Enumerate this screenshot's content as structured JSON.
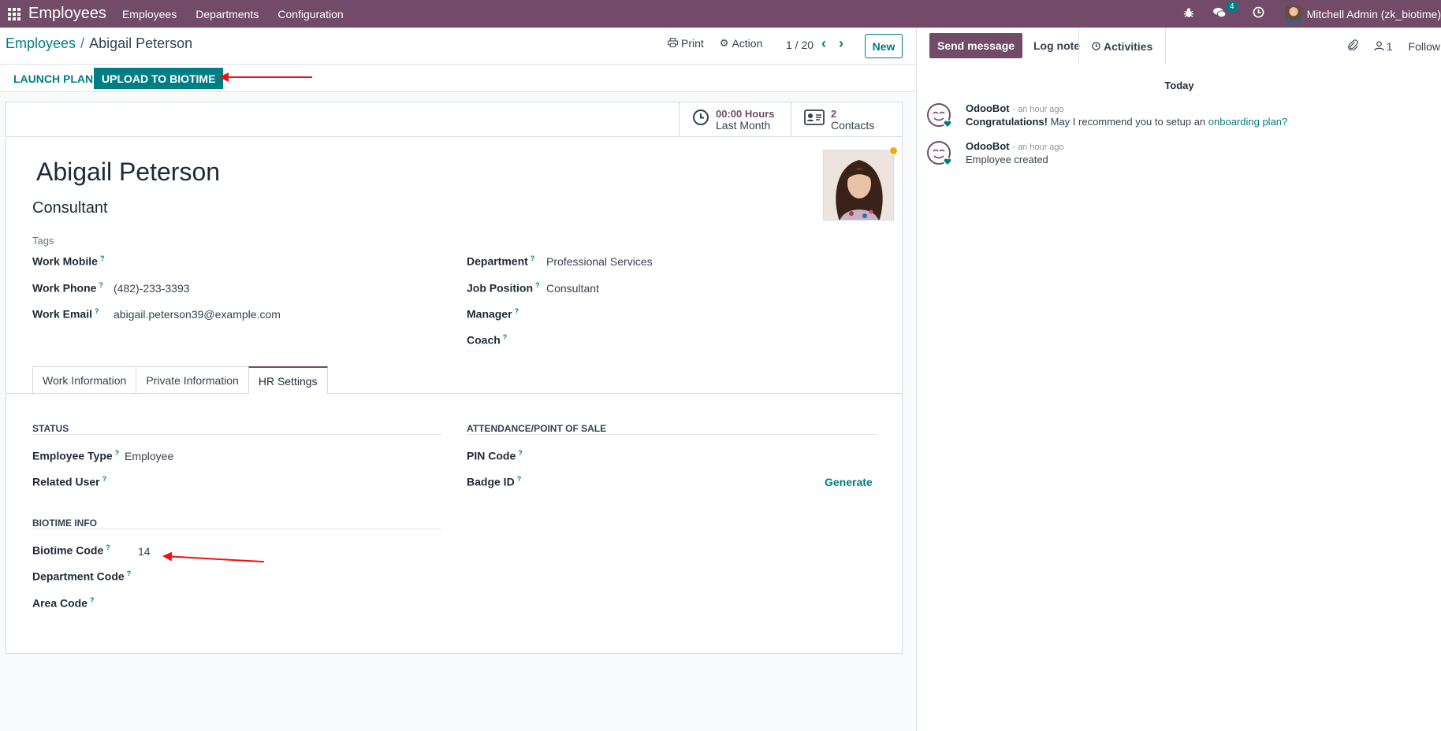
{
  "navbar": {
    "brand": "Employees",
    "menus": [
      "Employees",
      "Departments",
      "Configuration"
    ],
    "messages_count": "4",
    "user": "Mitchell Admin (zk_biotime)"
  },
  "breadcrumb": {
    "parent": "Employees",
    "separator": "/",
    "current": "Abigail Peterson"
  },
  "control": {
    "print_label": "Print",
    "action_label": "Action",
    "pager": "1 / 20",
    "new_label": "New"
  },
  "statusbar": {
    "launch_plan": "LAUNCH PLAN",
    "upload_biotime": "UPLOAD TO BIOTIME"
  },
  "smart_buttons": {
    "hours_value": "00:00 Hours",
    "hours_label": "Last Month",
    "contacts_value": "2",
    "contacts_label": "Contacts"
  },
  "employee": {
    "name": "Abigail Peterson",
    "job_title": "Consultant",
    "tags_placeholder": "Tags"
  },
  "fields": {
    "work_mobile": {
      "label": "Work Mobile",
      "value": ""
    },
    "work_phone": {
      "label": "Work Phone",
      "value": "(482)-233-3393"
    },
    "work_email": {
      "label": "Work Email",
      "value": "abigail.peterson39@example.com"
    },
    "department": {
      "label": "Department",
      "value": "Professional Services"
    },
    "job_position": {
      "label": "Job Position",
      "value": "Consultant"
    },
    "manager": {
      "label": "Manager",
      "value": ""
    },
    "coach": {
      "label": "Coach",
      "value": ""
    }
  },
  "tabs": [
    "Work Information",
    "Private Information",
    "HR Settings"
  ],
  "hr": {
    "status_title": "STATUS",
    "employee_type_label": "Employee Type",
    "employee_type_value": "Employee",
    "related_user_label": "Related User",
    "attendance_title": "ATTENDANCE/POINT OF SALE",
    "pin_code_label": "PIN Code",
    "badge_id_label": "Badge ID",
    "generate_label": "Generate",
    "biotime_title": "BIOTIME INFO",
    "biotime_code_label": "Biotime Code",
    "biotime_code_value": "14",
    "department_code_label": "Department Code",
    "area_code_label": "Area Code"
  },
  "chatter": {
    "send_message": "Send message",
    "log_note": "Log note",
    "activities": "Activities",
    "followers_count": "1",
    "follow": "Follow",
    "date_separator": "Today",
    "messages": [
      {
        "author": "OdooBot",
        "time": "- an hour ago",
        "bold": "Congratulations!",
        "text": " May I recommend you to setup an ",
        "link": "onboarding plan?"
      },
      {
        "author": "OdooBot",
        "time": "- an hour ago",
        "text": "Employee created"
      }
    ]
  },
  "colors": {
    "brand": "#714B67",
    "accent": "#017e84",
    "annotation_arrow": "#e11111"
  }
}
